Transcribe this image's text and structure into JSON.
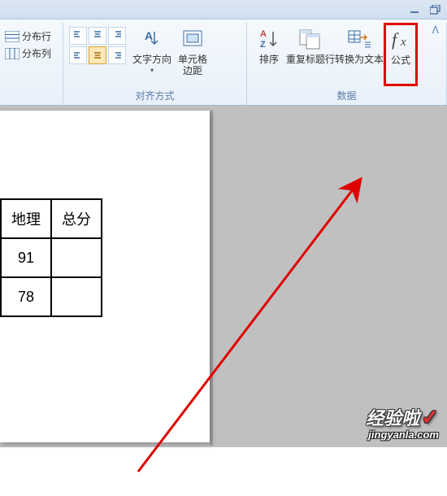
{
  "window": {
    "min_title": "Minimize",
    "max_title": "Restore",
    "collapse": "^"
  },
  "ribbon": {
    "distribute": {
      "rows": "分布行",
      "cols": "分布列"
    },
    "align_group": "对齐方式",
    "text_dir": "文字方向",
    "cell_margin": "单元格\n边距",
    "data_group": "数据",
    "sort": "排序",
    "repeat_header": "重复标题行",
    "to_text": "转换为文本",
    "formula": "公式"
  },
  "table": {
    "h1": "地理",
    "h2": "总分",
    "r1c1": "91",
    "r1c2": "",
    "r2c1": "78",
    "r2c2": ""
  },
  "watermark": {
    "main": "经验啦",
    "sub": "jingyanla.com"
  }
}
